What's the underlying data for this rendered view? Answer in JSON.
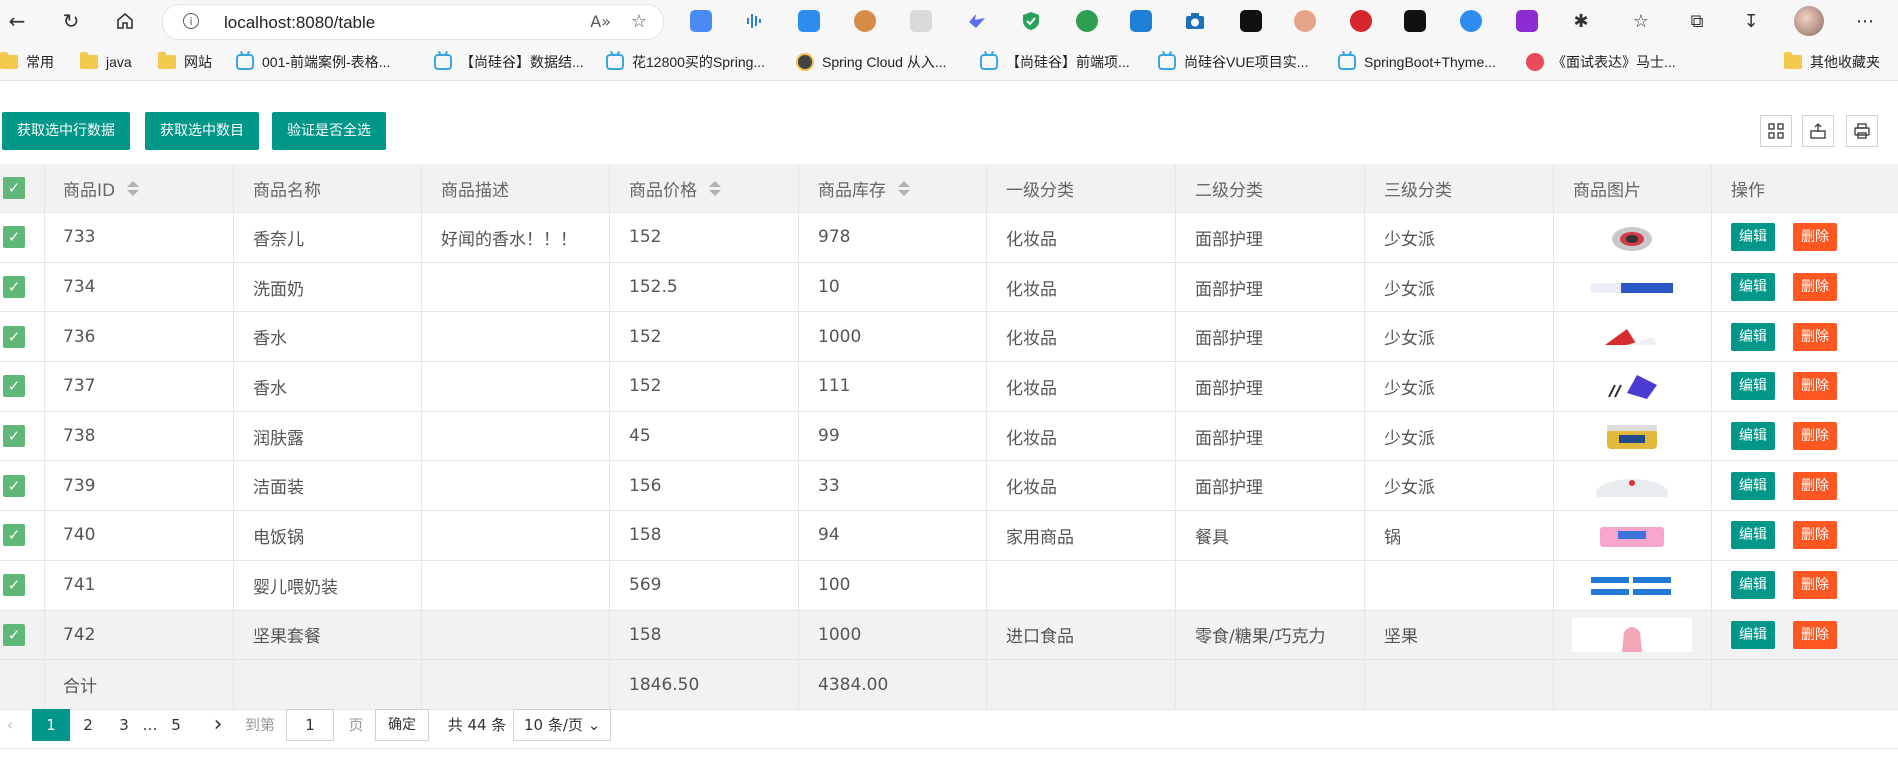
{
  "browser": {
    "url": "localhost:8080/table",
    "read_aloud_icon": "A»",
    "bookmarks": [
      {
        "type": "folder",
        "label": "常用"
      },
      {
        "type": "folder",
        "label": "java"
      },
      {
        "type": "folder",
        "label": "网站"
      },
      {
        "type": "bili",
        "label": "001-前端案例-表格..."
      },
      {
        "type": "bili",
        "label": "【尚硅谷】数据结..."
      },
      {
        "type": "bili",
        "label": "花12800买的Spring..."
      },
      {
        "type": "face",
        "label": "Spring Cloud 从入..."
      },
      {
        "type": "bili",
        "label": "【尚硅谷】前端项..."
      },
      {
        "type": "bili",
        "label": "尚硅谷VUE项目实..."
      },
      {
        "type": "bili",
        "label": "SpringBoot+Thyme..."
      },
      {
        "type": "red",
        "label": "《面试表达》马士..."
      }
    ],
    "other_bookmarks": "其他收藏夹"
  },
  "toolbar": {
    "btn_get_rows": "获取选中行数据",
    "btn_get_count": "获取选中数目",
    "btn_check_all": "验证是否全选"
  },
  "table": {
    "columns": [
      "商品ID",
      "商品名称",
      "商品描述",
      "商品价格",
      "商品库存",
      "一级分类",
      "二级分类",
      "三级分类",
      "商品图片",
      "操作"
    ],
    "rows": [
      {
        "id": "733",
        "name": "香奈儿",
        "desc": "好闻的香水！！！",
        "price": "152",
        "stock": "978",
        "c1": "化妆品",
        "c2": "面部护理",
        "c3": "少女派"
      },
      {
        "id": "734",
        "name": "洗面奶",
        "desc": "",
        "price": "152.5",
        "stock": "10",
        "c1": "化妆品",
        "c2": "面部护理",
        "c3": "少女派"
      },
      {
        "id": "736",
        "name": "香水",
        "desc": "",
        "price": "152",
        "stock": "1000",
        "c1": "化妆品",
        "c2": "面部护理",
        "c3": "少女派"
      },
      {
        "id": "737",
        "name": "香水",
        "desc": "",
        "price": "152",
        "stock": "111",
        "c1": "化妆品",
        "c2": "面部护理",
        "c3": "少女派"
      },
      {
        "id": "738",
        "name": "润肤露",
        "desc": "",
        "price": "45",
        "stock": "99",
        "c1": "化妆品",
        "c2": "面部护理",
        "c3": "少女派"
      },
      {
        "id": "739",
        "name": "洁面装",
        "desc": "",
        "price": "156",
        "stock": "33",
        "c1": "化妆品",
        "c2": "面部护理",
        "c3": "少女派"
      },
      {
        "id": "740",
        "name": "电饭锅",
        "desc": "",
        "price": "158",
        "stock": "94",
        "c1": "家用商品",
        "c2": "餐具",
        "c3": "锅"
      },
      {
        "id": "741",
        "name": "婴儿喂奶装",
        "desc": "",
        "price": "569",
        "stock": "100",
        "c1": "",
        "c2": "",
        "c3": ""
      },
      {
        "id": "742",
        "name": "坚果套餐",
        "desc": "",
        "price": "158",
        "stock": "1000",
        "c1": "进口食品",
        "c2": "零食/糖果/巧克力",
        "c3": "坚果"
      }
    ],
    "edit_label": "编辑",
    "delete_label": "删除",
    "total_label": "合计",
    "total_price": "1846.50",
    "total_stock": "4384.00"
  },
  "pager": {
    "pages": [
      "1",
      "2",
      "3",
      "…",
      "5"
    ],
    "goto_label": "到第",
    "goto_value": "1",
    "page_unit": "页",
    "confirm": "确定",
    "total": "共 44 条",
    "page_size": "10 条/页"
  }
}
